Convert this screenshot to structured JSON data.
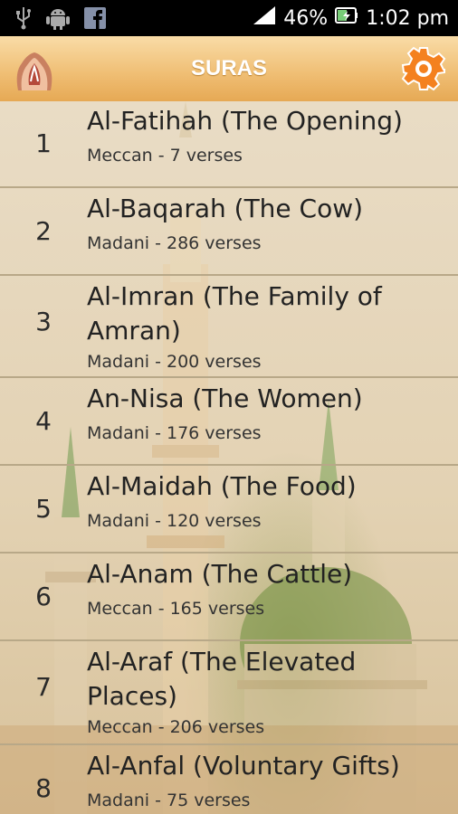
{
  "status": {
    "icons": [
      "usb-icon",
      "android-icon",
      "facebook-icon"
    ],
    "battery": "46%",
    "time": "1:02 pm"
  },
  "appbar": {
    "title": "SURAS"
  },
  "suras": [
    {
      "num": "1",
      "name": "Al-Fatihah (The Opening)",
      "info": "Meccan - 7 verses"
    },
    {
      "num": "2",
      "name": "Al-Baqarah (The Cow)",
      "info": "Madani - 286 verses"
    },
    {
      "num": "3",
      "name": "Al-Imran (The Family of Amran)",
      "info": "Madani - 200 verses"
    },
    {
      "num": "4",
      "name": "An-Nisa (The Women)",
      "info": "Madani - 176 verses"
    },
    {
      "num": "5",
      "name": "Al-Maidah (The Food)",
      "info": "Madani - 120 verses"
    },
    {
      "num": "6",
      "name": "Al-Anam (The Cattle)",
      "info": "Meccan - 165 verses"
    },
    {
      "num": "7",
      "name": "Al-Araf (The Elevated Places)",
      "info": "Meccan - 206 verses"
    },
    {
      "num": "8",
      "name": "Al-Anfal (Voluntary Gifts)",
      "info": "Madani - 75 verses"
    }
  ]
}
